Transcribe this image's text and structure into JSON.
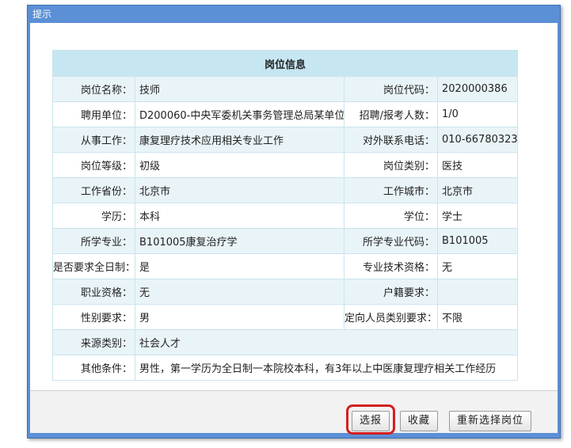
{
  "dialog": {
    "title": "提示"
  },
  "table": {
    "header": "岗位信息",
    "rows": [
      [
        "岗位名称：",
        "技师",
        "岗位代码：",
        "2020000386"
      ],
      [
        "聘用单位：",
        "D200060-中央军委机关事务管理总局某单位",
        "招聘/报考人数：",
        "1/0"
      ],
      [
        "从事工作：",
        "康复理疗技术应用相关专业工作",
        "对外联系电话：",
        "010-66780323"
      ],
      [
        "岗位等级：",
        "初级",
        "岗位类别：",
        "医技"
      ],
      [
        "工作省份：",
        "北京市",
        "工作城市：",
        "北京市"
      ],
      [
        "学历：",
        "本科",
        "学位：",
        "学士"
      ],
      [
        "所学专业：",
        "B101005康复治疗学",
        "所学专业代码：",
        "B101005"
      ],
      [
        "是否要求全日制：",
        "是",
        "专业技术资格：",
        "无"
      ],
      [
        "职业资格：",
        "无",
        "户籍要求：",
        ""
      ],
      [
        "性别要求：",
        "男",
        "定向人员类别要求：",
        "不限"
      ]
    ],
    "source_label": "来源类别：",
    "source_value": "社会人才",
    "other_label": "其他条件：",
    "other_value": "男性，第一学历为全日制一本院校本科，有3年以上中医康复理疗相关工作经历"
  },
  "buttons": {
    "apply": "选报",
    "favorite": "收藏",
    "reselect": "重新选择岗位"
  },
  "colors": {
    "titlebar": "#5b8fd6",
    "header_bg": "#c6e6f2",
    "row_alt_bg": "#e9f4f8",
    "highlight": "#d42020"
  }
}
